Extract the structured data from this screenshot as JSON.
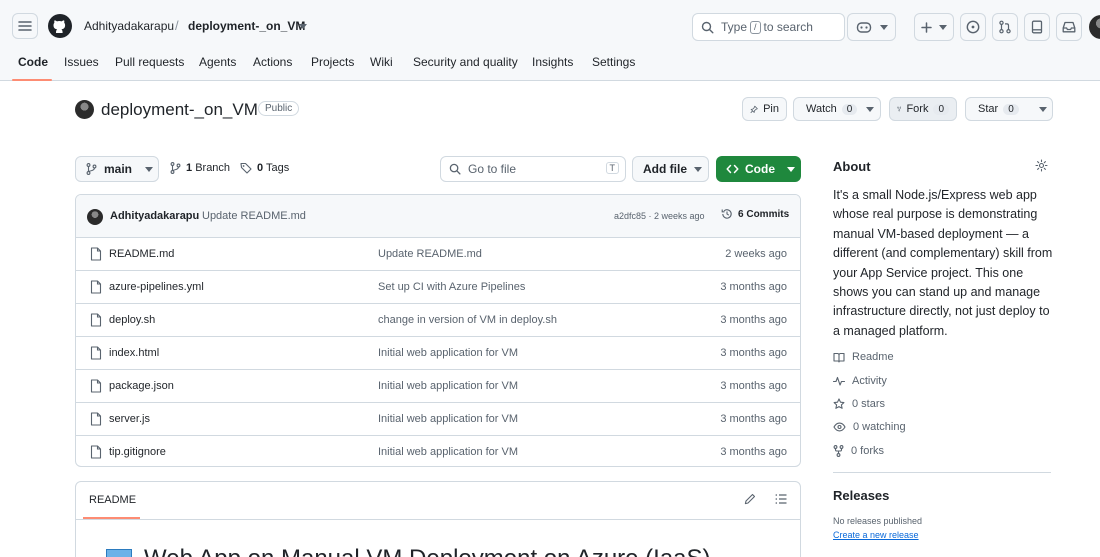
{
  "header": {
    "owner": "Adhityadakarapu",
    "separator": "/",
    "repo": "deployment-_on_VM",
    "search": {
      "prefix": "Type",
      "key": "/",
      "suffix": "to search"
    }
  },
  "tabs": [
    {
      "label": "Code"
    },
    {
      "label": "Issues"
    },
    {
      "label": "Pull requests"
    },
    {
      "label": "Agents"
    },
    {
      "label": "Actions"
    },
    {
      "label": "Projects"
    },
    {
      "label": "Wiki"
    },
    {
      "label": "Security and quality"
    },
    {
      "label": "Insights"
    },
    {
      "label": "Settings"
    }
  ],
  "repo_header": {
    "title": "deployment-_on_VM",
    "visibility": "Public",
    "pin": "Pin",
    "watch": {
      "label": "Watch",
      "count": "0"
    },
    "fork": {
      "label": "Fork",
      "count": "0"
    },
    "star": {
      "label": "Star",
      "count": "0"
    }
  },
  "toolbar": {
    "branch": "main",
    "branches": {
      "count": "1",
      "label": "Branch"
    },
    "tags": {
      "count": "0",
      "label": "Tags"
    },
    "goto_placeholder": "Go to file",
    "goto_key": "T",
    "add_file": "Add file",
    "code": "Code"
  },
  "latest_commit": {
    "author": "Adhityadakarapu",
    "message": "Update README.md",
    "hash_time": "a2dfc85 · 2 weeks ago",
    "commits": {
      "count": "6",
      "label": "Commits"
    }
  },
  "files": [
    {
      "name": "README.md",
      "message": "Update README.md",
      "date": "2 weeks ago"
    },
    {
      "name": "azure-pipelines.yml",
      "message": "Set up CI with Azure Pipelines",
      "date": "3 months ago"
    },
    {
      "name": "deploy.sh",
      "message": "change in version of VM in deploy.sh",
      "date": "3 months ago"
    },
    {
      "name": "index.html",
      "message": "Initial web application for VM",
      "date": "3 months ago"
    },
    {
      "name": "package.json",
      "message": "Initial web application for VM",
      "date": "3 months ago"
    },
    {
      "name": "server.js",
      "message": "Initial web application for VM",
      "date": "3 months ago"
    },
    {
      "name": "tip.gitignore",
      "message": "Initial web application for VM",
      "date": "3 months ago"
    }
  ],
  "readme": {
    "tab": "README",
    "heading": "Web App on Manual VM Deployment on Azure (IaaS)"
  },
  "about": {
    "heading": "About",
    "description": "It's a small Node.js/Express web app whose real purpose is demonstrating manual VM-based deployment — a different (and complementary) skill from your App Service project. This one shows you can stand up and manage infrastructure directly, not just deploy to a managed platform.",
    "items": [
      {
        "label": "Readme",
        "icon": "book-icon"
      },
      {
        "label": "Activity",
        "icon": "pulse-icon"
      },
      {
        "label": "0 stars",
        "icon": "star-icon"
      },
      {
        "label": "0 watching",
        "icon": "eye-icon"
      },
      {
        "label": "0 forks",
        "icon": "fork-icon"
      }
    ]
  },
  "releases": {
    "heading": "Releases",
    "none": "No releases published",
    "create": "Create a new release"
  },
  "colors": {
    "accent_green": "#1f883d",
    "tab_underline": "#fd8c73",
    "link_blue": "#0969da"
  }
}
